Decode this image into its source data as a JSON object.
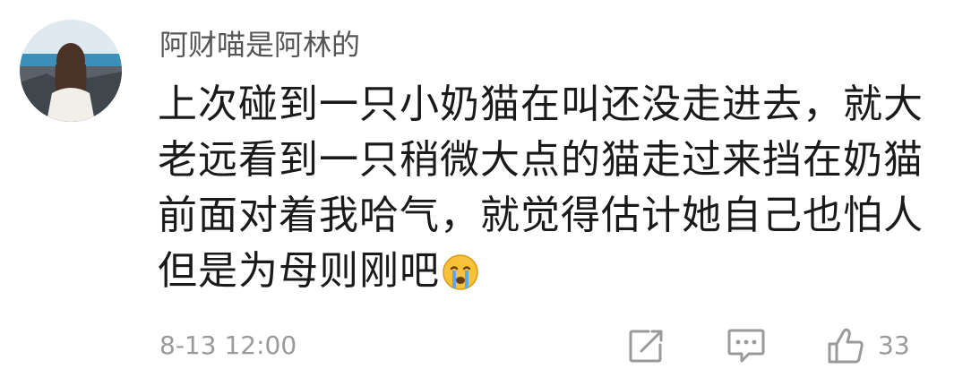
{
  "comment": {
    "username": "阿财喵是阿林的",
    "lines": [
      "上次碰到一只小奶猫在叫还没走进去，就大",
      "老远看到一只稍微大点的猫走过来挡在奶猫",
      "前面对着我哈气，就觉得估计她自己也怕人",
      "但是为母则刚吧"
    ],
    "emoji": "crying-face-emoji",
    "timestamp": "8-13 12:00",
    "actions": {
      "share_icon": "share-icon",
      "reply_icon": "comment-icon",
      "like_icon": "thumbs-up-icon",
      "like_count": "33"
    }
  },
  "colors": {
    "username": "#555555",
    "text": "#1a1a1a",
    "meta": "#9a9a9a",
    "emoji_face": "#f7c23a",
    "emoji_tears": "#5fa8e8"
  }
}
